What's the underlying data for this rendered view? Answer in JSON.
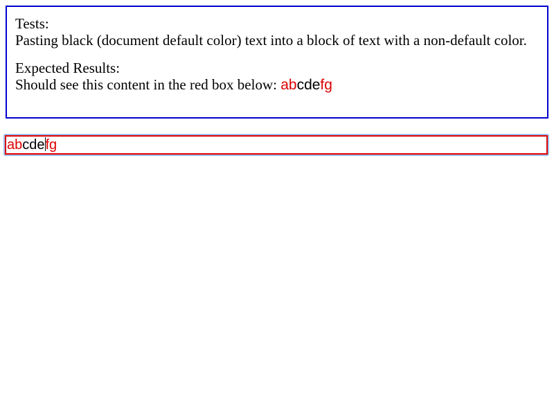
{
  "tests": {
    "heading": "Tests:",
    "description": "Pasting black (document default color) text into a block of text with a non-default color."
  },
  "expected": {
    "heading": "Expected Results:",
    "prefix": "Should see this content in the red box below: ",
    "sample_red_start": "ab",
    "sample_black": "cde",
    "sample_red_end": "fg"
  },
  "editor": {
    "red_start": "ab",
    "black": "cde",
    "red_end": "fg"
  },
  "colors": {
    "info_border": "#0000cc",
    "editor_border": "#dd0000",
    "highlight_text": "#dd0000",
    "focus_ring": "#9ec3ee"
  }
}
